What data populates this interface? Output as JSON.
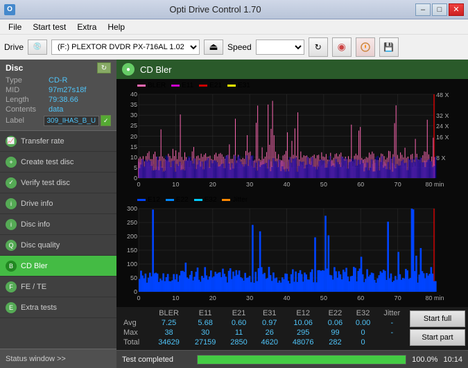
{
  "titlebar": {
    "icon": "O",
    "title": "Opti Drive Control 1.70",
    "min_label": "–",
    "max_label": "□",
    "close_label": "✕"
  },
  "menubar": {
    "items": [
      "File",
      "Start test",
      "Extra",
      "Help"
    ]
  },
  "drivebar": {
    "drive_label": "Drive",
    "drive_value": "(F:)  PLEXTOR DVDR   PX-716AL 1.02",
    "speed_label": "Speed",
    "eject_icon": "⏏",
    "refresh_icon": "↻",
    "erase_icon": "◉",
    "burn_icon": "🔥",
    "save_icon": "💾"
  },
  "disc": {
    "title": "Disc",
    "type_label": "Type",
    "type_value": "CD-R",
    "mid_label": "MID",
    "mid_value": "97m27s18f",
    "length_label": "Length",
    "length_value": "79:38.66",
    "contents_label": "Contents",
    "contents_value": "data",
    "label_label": "Label",
    "label_value": "309_IHAS_B_U"
  },
  "sidebar": {
    "items": [
      {
        "id": "transfer-rate",
        "label": "Transfer rate",
        "active": false
      },
      {
        "id": "create-test-disc",
        "label": "Create test disc",
        "active": false
      },
      {
        "id": "verify-test-disc",
        "label": "Verify test disc",
        "active": false
      },
      {
        "id": "drive-info",
        "label": "Drive info",
        "active": false
      },
      {
        "id": "disc-info",
        "label": "Disc info",
        "active": false
      },
      {
        "id": "disc-quality",
        "label": "Disc quality",
        "active": false
      },
      {
        "id": "cd-bler",
        "label": "CD Bler",
        "active": true
      },
      {
        "id": "fe-te",
        "label": "FE / TE",
        "active": false
      },
      {
        "id": "extra-tests",
        "label": "Extra tests",
        "active": false
      }
    ],
    "status_window": "Status window >>"
  },
  "chart": {
    "title": "CD Bler",
    "upper_legend": [
      {
        "label": "BLER",
        "color": "#ff69b4"
      },
      {
        "label": "E11",
        "color": "#cc00cc"
      },
      {
        "label": "E21",
        "color": "#cc0000"
      },
      {
        "label": "E31",
        "color": "#ffff00"
      }
    ],
    "lower_legend": [
      {
        "label": "E12",
        "color": "#0044ff"
      },
      {
        "label": "E22",
        "color": "#0088ff"
      },
      {
        "label": "E32",
        "color": "#00ccff"
      },
      {
        "label": "Jitter",
        "color": "#ff8800"
      }
    ],
    "x_max": 80,
    "upper_y_max": 40,
    "lower_y_max": 300,
    "right_axis_upper": [
      "48 X",
      "32 X",
      "24 X",
      "16 X",
      "8 X"
    ],
    "x_labels": [
      "0",
      "10",
      "20",
      "30",
      "40",
      "50",
      "60",
      "70",
      "80 min"
    ],
    "min_label": "min"
  },
  "table": {
    "headers": [
      "",
      "BLER",
      "E11",
      "E21",
      "E31",
      "E12",
      "E22",
      "E32",
      "Jitter"
    ],
    "rows": [
      {
        "label": "Avg",
        "values": [
          "7.25",
          "5.68",
          "0.60",
          "0.97",
          "10.06",
          "0.06",
          "0.00",
          "-"
        ]
      },
      {
        "label": "Max",
        "values": [
          "38",
          "30",
          "11",
          "26",
          "295",
          "99",
          "0",
          "-"
        ]
      },
      {
        "label": "Total",
        "values": [
          "34629",
          "27159",
          "2850",
          "4620",
          "48076",
          "282",
          "0",
          ""
        ]
      }
    ]
  },
  "buttons": {
    "start_full": "Start full",
    "start_part": "Start part"
  },
  "statusbar": {
    "status_text": "Test completed",
    "progress": 100,
    "progress_text": "100.0%",
    "time_text": "10:14"
  },
  "colors": {
    "accent_green": "#44bb44",
    "sidebar_bg": "#404040",
    "content_bg": "#1a1a1a",
    "chart_header_bg": "#2a5a2a"
  }
}
